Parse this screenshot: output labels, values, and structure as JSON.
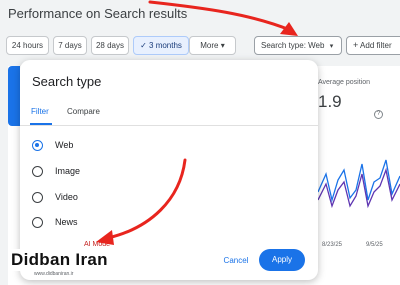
{
  "page": {
    "title": "Performance on Search results"
  },
  "toolbar": {
    "ranges": [
      {
        "label": "24 hours",
        "selected": false
      },
      {
        "label": "7 days",
        "selected": false
      },
      {
        "label": "28 days",
        "selected": false
      },
      {
        "label": "3 months",
        "selected": true
      },
      {
        "label": "More",
        "selected": false
      }
    ],
    "search_type_label": "Search type: Web",
    "add_filter_label": "Add filter"
  },
  "metrics": {
    "avg_position_label": "Average position",
    "avg_position_value": "1.9"
  },
  "chart": {
    "dates": [
      "8/23/25",
      "9/5/25"
    ]
  },
  "dialog": {
    "title": "Search type",
    "tabs": [
      {
        "label": "Filter",
        "active": true
      },
      {
        "label": "Compare",
        "active": false
      }
    ],
    "options": [
      {
        "label": "Web",
        "selected": true
      },
      {
        "label": "Image",
        "selected": false
      },
      {
        "label": "Video",
        "selected": false
      },
      {
        "label": "News",
        "selected": false
      }
    ],
    "ai_mode_label": "AI Mode",
    "cancel_label": "Cancel",
    "apply_label": "Apply"
  },
  "watermark": {
    "text": "Didban Iran",
    "url": "www.didbaniran.ir"
  },
  "colors": {
    "accent": "#1a73e8",
    "annotation_arrow": "#e8251e",
    "ai_mode": "#c5221f"
  }
}
